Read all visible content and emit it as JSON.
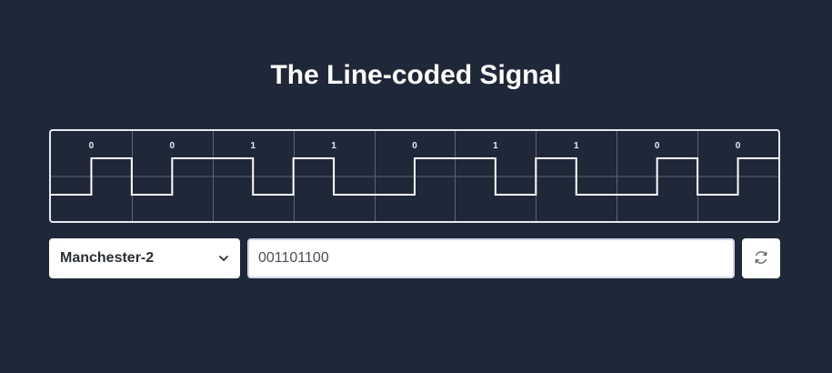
{
  "page": {
    "title": "The Line-coded Signal"
  },
  "signal": {
    "encoding": "Manchester-2",
    "bits": [
      "0",
      "0",
      "1",
      "1",
      "0",
      "1",
      "1",
      "0",
      "0"
    ],
    "colors": {
      "background": "#1f2839",
      "grid": "#5b6577",
      "waveform": "#ffffff",
      "bit_label": "#e8ebf0"
    }
  },
  "controls": {
    "encoding_select": {
      "selected": "Manchester-2"
    },
    "bits_input": {
      "value": "001101100"
    },
    "refresh_button": {
      "icon": "refresh-icon"
    }
  }
}
